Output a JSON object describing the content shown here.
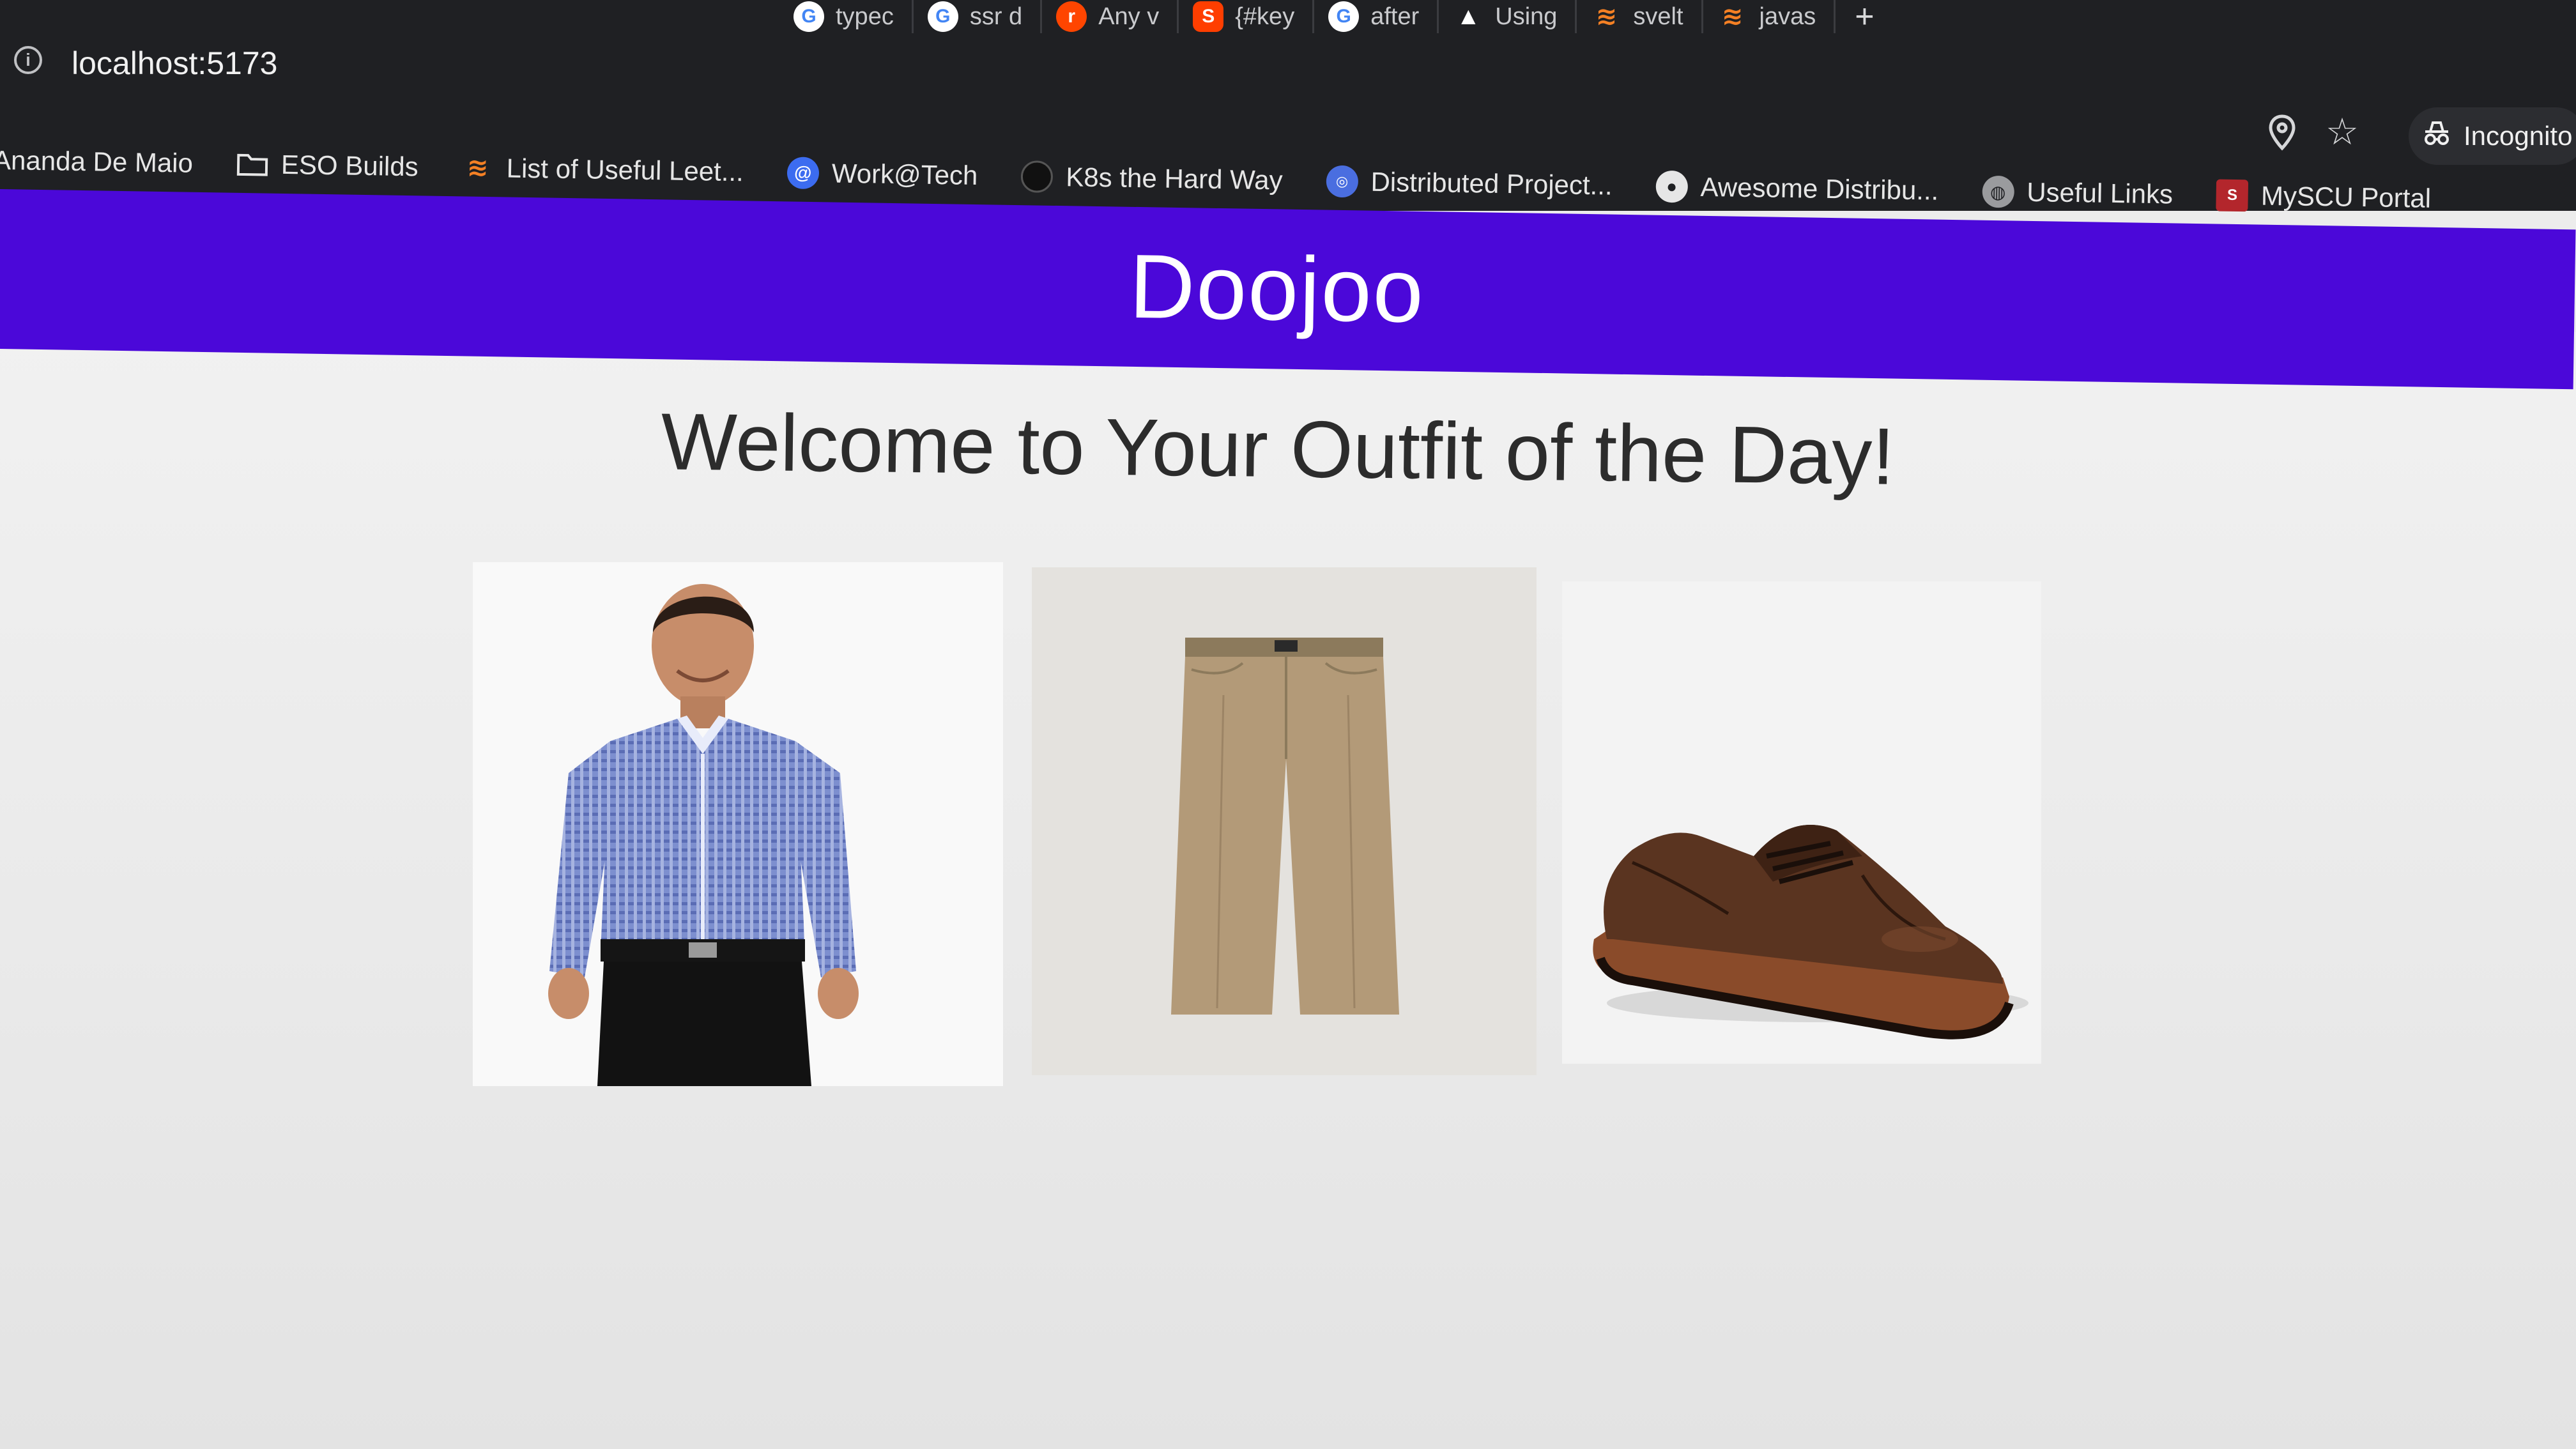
{
  "browser": {
    "tabs": [
      {
        "label": "typec",
        "icon": "google-icon",
        "color": "#4285f4"
      },
      {
        "label": "ssr d",
        "icon": "google-icon",
        "color": "#4285f4"
      },
      {
        "label": "Any v",
        "icon": "reddit-icon",
        "color": "#ff4500"
      },
      {
        "label": "{#key",
        "icon": "svelte-icon",
        "color": "#ff3e00"
      },
      {
        "label": "after",
        "icon": "google-icon",
        "color": "#4285f4"
      },
      {
        "label": "Using",
        "icon": "vercel-icon",
        "color": "#ffffff"
      },
      {
        "label": "svelt",
        "icon": "stackoverflow-icon",
        "color": "#f48024"
      },
      {
        "label": "javas",
        "icon": "stackoverflow-icon",
        "color": "#f48024"
      }
    ],
    "new_tab": "+",
    "url": "localhost:5173",
    "incognito_label": "Incognito",
    "bookmarks": [
      {
        "label": "Ananda De Maio",
        "icon": "none"
      },
      {
        "label": "ESO Builds",
        "icon": "folder-icon"
      },
      {
        "label": "List of Useful Leet...",
        "icon": "stackoverflow-icon"
      },
      {
        "label": "Work@Tech",
        "icon": "at-icon"
      },
      {
        "label": "K8s the Hard Way",
        "icon": "github-icon"
      },
      {
        "label": "Distributed Project...",
        "icon": "site-icon"
      },
      {
        "label": "Awesome Distribu...",
        "icon": "github-icon"
      },
      {
        "label": "Useful Links",
        "icon": "globe-icon"
      },
      {
        "label": "MySCU Portal",
        "icon": "scu-icon"
      }
    ]
  },
  "site": {
    "brand": "Doojoo",
    "header_color": "#4b08d9",
    "title": "Welcome to Your Outfit of the Day!",
    "outfit": [
      {
        "item": "shirt",
        "icon": "model-in-checked-shirt-image"
      },
      {
        "item": "pants",
        "icon": "khaki-pants-image"
      },
      {
        "item": "shoes",
        "icon": "brown-wingtip-shoe-image"
      }
    ]
  }
}
